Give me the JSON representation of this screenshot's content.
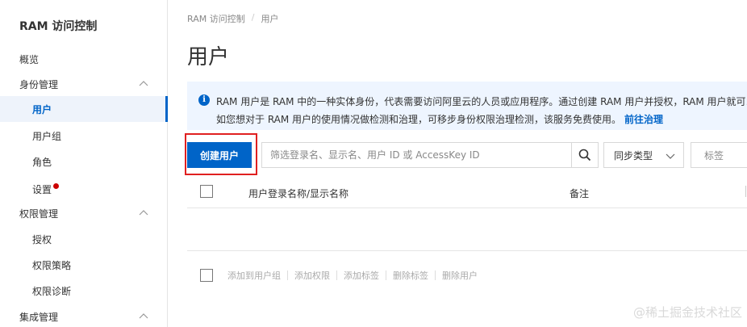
{
  "sidebar": {
    "title": "RAM 访问控制",
    "items": [
      {
        "label": "概览"
      },
      {
        "label": "身份管理"
      },
      {
        "label": "用户"
      },
      {
        "label": "用户组"
      },
      {
        "label": "角色"
      },
      {
        "label": "设置"
      },
      {
        "label": "权限管理"
      },
      {
        "label": "授权"
      },
      {
        "label": "权限策略"
      },
      {
        "label": "权限诊断"
      },
      {
        "label": "集成管理"
      }
    ]
  },
  "breadcrumb": {
    "root": "RAM 访问控制",
    "separator": "/",
    "current": "用户"
  },
  "page_title": "用户",
  "info": {
    "line1": "RAM 用户是 RAM 中的一种实体身份，代表需要访问阿里云的人员或应用程序。通过创建 RAM 用户并授权，RAM 用户就可以",
    "line2": "如您想对于 RAM 用户的使用情况做检测和治理，可移步身份权限治理检测，该服务免费使用。",
    "link": "前往治理"
  },
  "toolbar": {
    "create_label": "创建用户",
    "search_placeholder": "筛选登录名、显示名、用户 ID 或 AccessKey ID",
    "sync_label": "同步类型",
    "tag_label": "标签"
  },
  "table": {
    "columns": [
      "用户登录名称/显示名称",
      "备注"
    ]
  },
  "footer_actions": [
    "添加到用户组",
    "添加权限",
    "添加标签",
    "删除标签",
    "删除用户"
  ],
  "watermark": "@稀土掘金技术社区",
  "colors": {
    "accent": "#0064c8",
    "highlight": "#e02020",
    "info_bg": "#eef5ff"
  }
}
